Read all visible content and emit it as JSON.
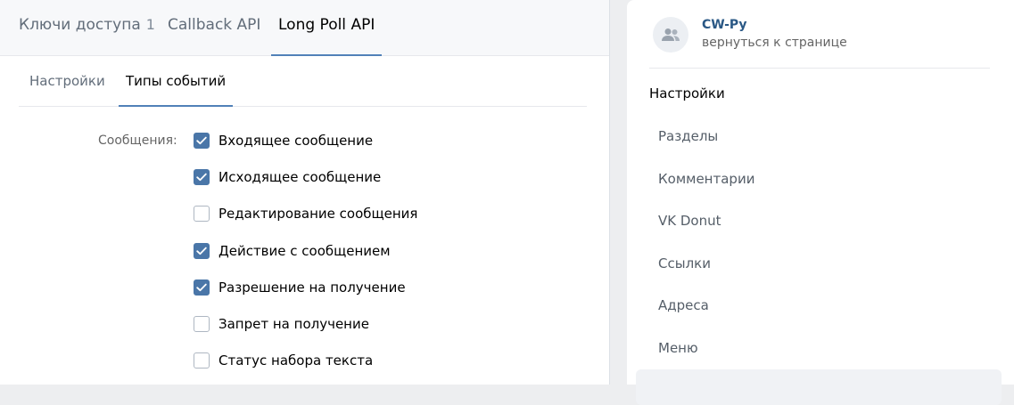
{
  "top_tabs": [
    {
      "label": "Ключи доступа",
      "count": "1"
    },
    {
      "label": "Callback API"
    },
    {
      "label": "Long Poll API"
    }
  ],
  "sub_tabs": [
    {
      "label": "Настройки"
    },
    {
      "label": "Типы событий"
    }
  ],
  "events": {
    "group_label": "Сообщения:",
    "items": [
      {
        "label": "Входящее сообщение",
        "checked": true
      },
      {
        "label": "Исходящее сообщение",
        "checked": true
      },
      {
        "label": "Редактирование сообщения",
        "checked": false
      },
      {
        "label": "Действие с сообщением",
        "checked": true
      },
      {
        "label": "Разрешение на получение",
        "checked": true
      },
      {
        "label": "Запрет на получение",
        "checked": false
      },
      {
        "label": "Статус набора текста",
        "checked": false
      }
    ]
  },
  "sidebar": {
    "group_name": "CW-Py",
    "back_link": "вернуться к странице",
    "heading": "Настройки",
    "items": [
      {
        "label": "Разделы"
      },
      {
        "label": "Комментарии"
      },
      {
        "label": "VK Donut"
      },
      {
        "label": "Ссылки"
      },
      {
        "label": "Адреса"
      },
      {
        "label": "Меню"
      }
    ]
  },
  "colors": {
    "accent": "#4a76a8",
    "tab_underline": "#5181b8",
    "link": "#2a5885"
  }
}
